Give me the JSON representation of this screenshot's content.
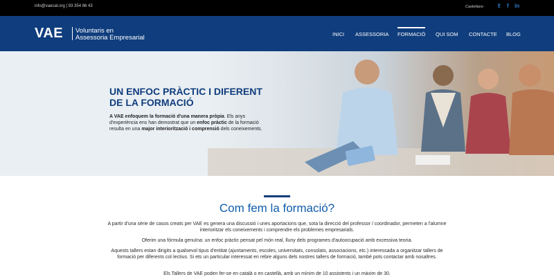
{
  "topbar": {
    "contact": "info@vaecat.org | 93 354 86 43",
    "language": "Castellano",
    "social": [
      "𝕥",
      "f",
      "in"
    ]
  },
  "header": {
    "logo_main": "VAE",
    "logo_line1": "Voluntaris en",
    "logo_line2": "Assessoria Empresarial",
    "nav": [
      "INICI",
      "ASSESSORIA",
      "FORMACIÓ",
      "QUI SOM",
      "CONTACTE",
      "BLOG"
    ],
    "active_nav": "FORMACIÓ"
  },
  "hero": {
    "title": "UN ENFOC PRÀCTIC I DIFERENT DE LA FORMACIÓ",
    "text_parts": [
      {
        "t": "A VAE enfoquem la formació d'una manera pròpia",
        "b": true
      },
      {
        "t": ". Els anys d'experiència ens han demostrat que un ",
        "b": false
      },
      {
        "t": "enfoc pràctic",
        "b": true
      },
      {
        "t": " de la formació resulta en una ",
        "b": false
      },
      {
        "t": "major interiorització i comprensió",
        "b": true
      },
      {
        "t": " dels coneixements.",
        "b": false
      }
    ]
  },
  "section": {
    "title": "Com fem la formació?",
    "p1": "A partir d'una sèrie de casos creats per VAE es genera una discussió i unes aportacions que, sota la direcció del professor / coordinador, permeten a l'alumne interioritzar els coneixements i comprendre els problemes empresarials.",
    "p2": "Oferim una fórmula genuïna: un enfoc pràctic pensat pel món real, lluny dels programes d'autoocupació amb excessiva teoria.",
    "p3": "Aquests tallers estan dirigits a qualsevol tipus d'entitat (ajuntaments, escoles, universitats, consolats, associacions, etc.) interessada a organitzar tallers de formació per diferents col·lectius. Si ets un particular interessat en rebre alguns dels nostres tallers de formació, també pots contactar amb nosaltres.",
    "p4": "Els Tallers de VAE poden fer-se en català o en castellà, amb un mínim de 10 assistents i un màxim de 30."
  },
  "colors": {
    "topbar": "#000000",
    "header": "#0f3d7d",
    "title_blue": "#0f3d7d",
    "section_title": "#0f5cab",
    "social": "#2f7fd1"
  }
}
